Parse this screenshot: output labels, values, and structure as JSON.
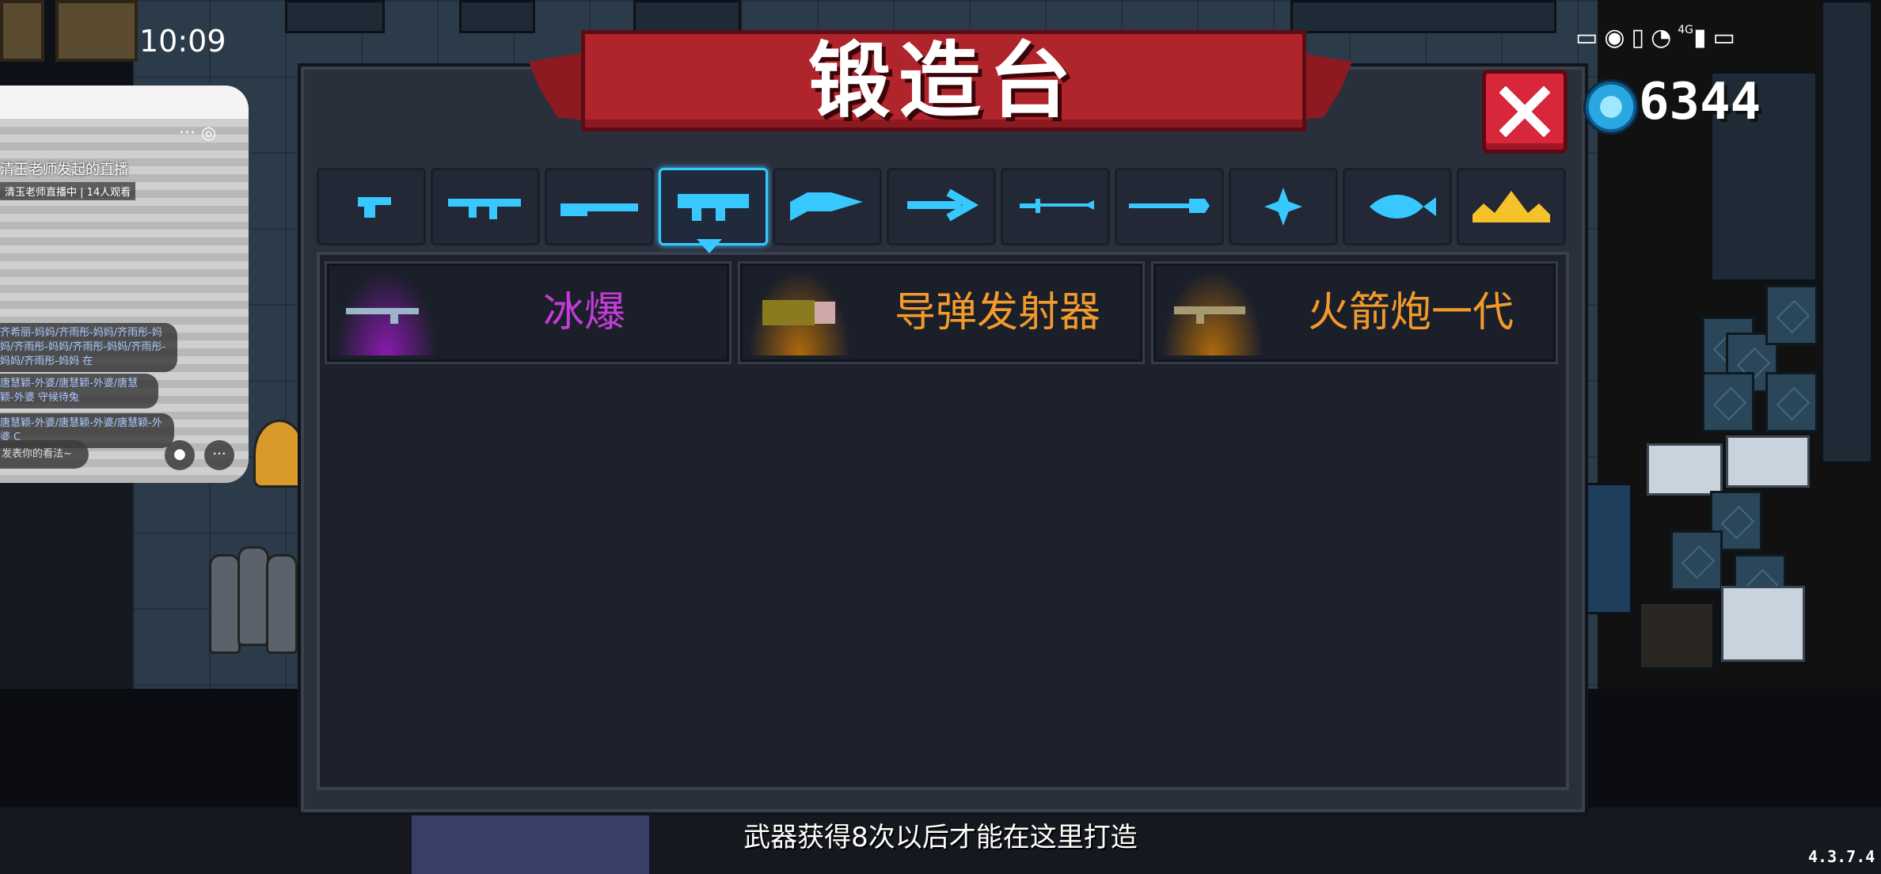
{
  "status_bar": {
    "time": "10:09",
    "icons": [
      "cast-icon",
      "eye-icon",
      "vibrate-icon",
      "wifi-icon",
      "signal-icon",
      "battery-icon"
    ],
    "network": "4G"
  },
  "live_overlay": {
    "title": "清玉老师发起的直播",
    "subtitle": "清玉老师直播中 | 14人观看",
    "comments": [
      {
        "text": "齐希丽-妈妈/齐雨彤-妈妈/齐雨彤-妈妈/齐雨彤-妈妈/齐雨彤-妈妈/齐雨彤-妈妈/齐雨彤-妈妈 在"
      },
      {
        "text": "唐慧颖-外婆/唐慧颖-外婆/唐慧颖-外婆 守候待兔"
      },
      {
        "text": "唐慧颖-外婆/唐慧颖-外婆/唐慧颖-外婆 C"
      }
    ],
    "input_placeholder": "发表你的看法~",
    "more_label": "···"
  },
  "forge": {
    "title": "锻造台",
    "currency_value": "6344",
    "tabs": [
      {
        "icon": "pistol-icon",
        "active": false
      },
      {
        "icon": "assault-rifle-icon",
        "active": false
      },
      {
        "icon": "shotgun-icon",
        "active": false
      },
      {
        "icon": "rocket-launcher-icon",
        "active": true
      },
      {
        "icon": "laser-gun-icon",
        "active": false
      },
      {
        "icon": "bow-icon",
        "active": false
      },
      {
        "icon": "sword-icon",
        "active": false
      },
      {
        "icon": "spear-icon",
        "active": false
      },
      {
        "icon": "shuriken-icon",
        "active": false
      },
      {
        "icon": "fish-icon",
        "active": false
      },
      {
        "icon": "crown-icon",
        "active": false
      }
    ],
    "weapons": [
      {
        "name": "冰爆",
        "color": "#c43bd6",
        "glow": "#6a1a8a"
      },
      {
        "name": "导弹发射器",
        "color": "#f29a2a",
        "glow": "#8a4e0a"
      },
      {
        "name": "火箭炮一代",
        "color": "#f29a2a",
        "glow": "#8a4e0a"
      }
    ],
    "hint": "武器获得8次以后才能在这里打造"
  },
  "version": "4.3.7.4",
  "colors": {
    "accent_cyan": "#37c8ff",
    "banner_red": "#b0242c",
    "close_red": "#d8263a",
    "crown_gold": "#f5c22a"
  }
}
